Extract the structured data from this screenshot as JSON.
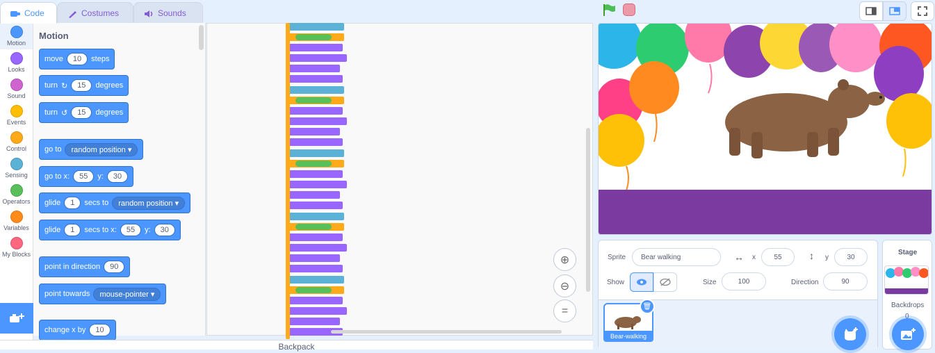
{
  "tabs": [
    {
      "label": "Code",
      "icon": "code-icon"
    },
    {
      "label": "Costumes",
      "icon": "brush-icon"
    },
    {
      "label": "Sounds",
      "icon": "speaker-icon"
    }
  ],
  "categories": [
    {
      "label": "Motion",
      "color": "#4c97ff"
    },
    {
      "label": "Looks",
      "color": "#9966ff"
    },
    {
      "label": "Sound",
      "color": "#cf63cf"
    },
    {
      "label": "Events",
      "color": "#ffbf00"
    },
    {
      "label": "Control",
      "color": "#ffab19"
    },
    {
      "label": "Sensing",
      "color": "#5cb1d6"
    },
    {
      "label": "Operators",
      "color": "#59c059"
    },
    {
      "label": "Variables",
      "color": "#ff8c1a"
    },
    {
      "label": "My Blocks",
      "color": "#ff6680"
    }
  ],
  "palette": {
    "title": "Motion",
    "move": {
      "a": "move",
      "v": "10",
      "b": "steps"
    },
    "turn_right": {
      "a": "turn",
      "v": "15",
      "b": "degrees"
    },
    "turn_left": {
      "a": "turn",
      "v": "15",
      "b": "degrees"
    },
    "goto": {
      "a": "go to",
      "opt": "random position"
    },
    "gotoxy": {
      "a": "go to x:",
      "x": "55",
      "b": "y:",
      "y": "30"
    },
    "glide": {
      "a": "glide",
      "v": "1",
      "b": "secs to",
      "opt": "random position"
    },
    "glidexy": {
      "a": "glide",
      "v": "1",
      "b": "secs to x:",
      "x": "55",
      "c": "y:",
      "y": "30"
    },
    "point": {
      "a": "point in direction",
      "v": "90"
    },
    "towards": {
      "a": "point towards",
      "opt": "mouse-pointer"
    },
    "changex": {
      "a": "change x by",
      "v": "10"
    }
  },
  "backpack": "Backpack",
  "sprite": {
    "label_sprite": "Sprite",
    "name": "Bear walking",
    "label_x": "x",
    "x": "55",
    "label_y": "y",
    "y": "30",
    "label_show": "Show",
    "label_size": "Size",
    "size": "100",
    "label_direction": "Direction",
    "direction": "90",
    "thumb_label": "Bear-walking"
  },
  "stage_panel": {
    "title": "Stage",
    "backdrops_label": "Backdrops",
    "backdrops_count": "0"
  },
  "colors": {
    "accent": "#4c97ff",
    "stage_floor": "#7a3aa0"
  }
}
